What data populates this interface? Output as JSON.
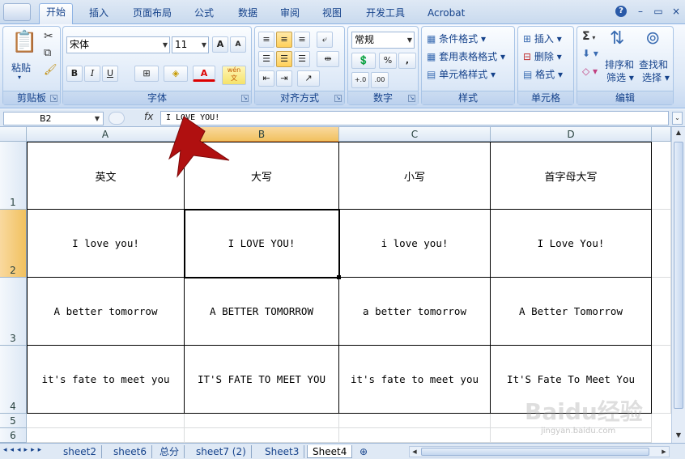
{
  "ribbon_tabs": [
    "开始",
    "插入",
    "页面布局",
    "公式",
    "数据",
    "审阅",
    "视图",
    "开发工具",
    "Acrobat"
  ],
  "window_controls": {
    "help": "?",
    "minimize": "–",
    "restore": "▭",
    "close": "×"
  },
  "groups": {
    "clipboard": {
      "label": "剪贴板",
      "paste": "粘贴"
    },
    "font": {
      "label": "字体",
      "name": "宋体",
      "size": "11",
      "bold": "B",
      "italic": "I",
      "underline": "U",
      "grow": "A",
      "shrink": "A",
      "font_color": "A",
      "phonetic": "wén\n文"
    },
    "alignment": {
      "label": "对齐方式"
    },
    "number": {
      "label": "数字",
      "format": "常规",
      "percent": "%",
      "comma": ",",
      "inc": "+.0",
      "dec": ".00"
    },
    "styles": {
      "label": "样式",
      "conditional": "条件格式",
      "table": "套用表格格式",
      "cell": "单元格样式"
    },
    "cells": {
      "label": "单元格",
      "insert": "插入",
      "delete": "删除",
      "format": "格式"
    },
    "editing": {
      "label": "编辑",
      "sum": "Σ",
      "sort": "排序和",
      "sort2": "筛选",
      "find": "查找和",
      "find2": "选择"
    }
  },
  "formula": {
    "name_box": "B2",
    "fx": "fx",
    "content": "I LOVE YOU!"
  },
  "columns": [
    "A",
    "B",
    "C",
    "D"
  ],
  "rows": [
    "1",
    "2",
    "3",
    "4",
    "5",
    "6"
  ],
  "table": [
    [
      "英文",
      "大写",
      "小写",
      "首字母大写"
    ],
    [
      "I love you!",
      "I LOVE YOU!",
      "i love you!",
      "I Love You!"
    ],
    [
      "A better tomorrow",
      "A BETTER TOMORROW",
      "a better tomorrow",
      "A Better Tomorrow"
    ],
    [
      "it's fate to meet you",
      "IT'S FATE TO MEET YOU",
      "it's fate to meet you",
      "It'S Fate To Meet You"
    ]
  ],
  "sheets": [
    "sheet2",
    "sheet6",
    "总分",
    "sheet7 (2)",
    "Sheet3",
    "Sheet4"
  ],
  "active_sheet": "Sheet4",
  "watermark": {
    "brand": "Baidu经验",
    "url": "jingyan.baidu.com"
  },
  "colors": {
    "accent": "#15428b",
    "selection": "#f1c15f",
    "annotation_arrow": "#b01010"
  }
}
